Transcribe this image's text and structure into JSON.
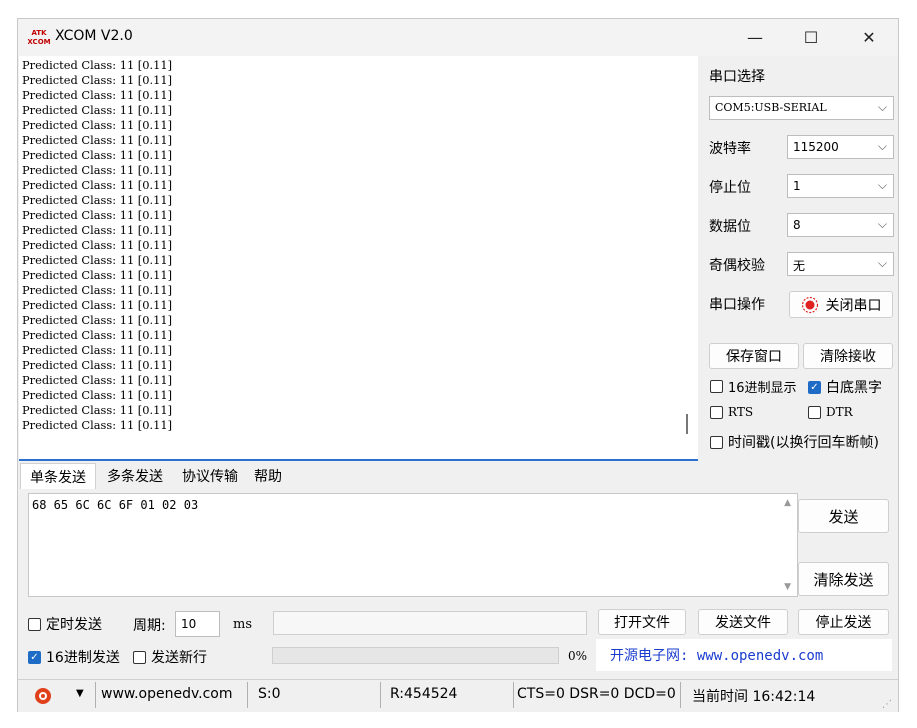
{
  "window": {
    "title": "XCOM V2.0",
    "icon_text": "ATK XCOM"
  },
  "receive": {
    "lines": [
      "Predicted Class: 11 [0.11]",
      "Predicted Class: 11 [0.11]",
      "Predicted Class: 11 [0.11]",
      "Predicted Class: 11 [0.11]",
      "Predicted Class: 11 [0.11]",
      "Predicted Class: 11 [0.11]",
      "Predicted Class: 11 [0.11]",
      "Predicted Class: 11 [0.11]",
      "Predicted Class: 11 [0.11]",
      "Predicted Class: 11 [0.11]",
      "Predicted Class: 11 [0.11]",
      "Predicted Class: 11 [0.11]",
      "Predicted Class: 11 [0.11]",
      "Predicted Class: 11 [0.11]",
      "Predicted Class: 11 [0.11]",
      "Predicted Class: 11 [0.11]",
      "Predicted Class: 11 [0.11]",
      "Predicted Class: 11 [0.11]",
      "Predicted Class: 11 [0.11]",
      "Predicted Class: 11 [0.11]",
      "Predicted Class: 11 [0.11]",
      "Predicted Class: 11 [0.11]",
      "Predicted Class: 11 [0.11]",
      "Predicted Class: 11 [0.11]",
      "Predicted Class: 11 [0.11]"
    ]
  },
  "serial": {
    "port_label": "串口选择",
    "port_value": "COM5:USB-SERIAL",
    "baud_label": "波特率",
    "baud_value": "115200",
    "stop_label": "停止位",
    "stop_value": "1",
    "data_label": "数据位",
    "data_value": "8",
    "parity_label": "奇偶校验",
    "parity_value": "无",
    "op_label": "串口操作",
    "close_port_label": "关闭串口",
    "save_window_label": "保存窗口",
    "clear_recv_label": "清除接收",
    "hex_display_label": "16进制显示",
    "white_black_label": "白底黑字",
    "rts_label": "RTS",
    "dtr_label": "DTR",
    "timestamp_label": "时间戳(以换行回车断帧)"
  },
  "tabs": [
    "单条发送",
    "多条发送",
    "协议传输",
    "帮助"
  ],
  "send": {
    "text": "68 65 6C 6C 6F 01 02 03",
    "send_label": "发送",
    "clear_send_label": "清除发送",
    "timed_send_label": "定时发送",
    "period_label": "周期:",
    "period_value": "10",
    "period_unit": "ms",
    "open_file_label": "打开文件",
    "send_file_label": "发送文件",
    "stop_send_label": "停止发送",
    "hex_send_label": "16进制发送",
    "send_newline_label": "发送新行",
    "progress_percent": "0%",
    "promo": "开源电子网: www.openedv.com"
  },
  "statusbar": {
    "url": "www.openedv.com",
    "sent": "S:0",
    "received": "R:454524",
    "lines": "CTS=0 DSR=0 DCD=0",
    "time": "当前时间 16:42:14"
  },
  "colors": {
    "accent": "#1e6cc6",
    "promo": "#1a3ccf",
    "record": "#e02020"
  }
}
